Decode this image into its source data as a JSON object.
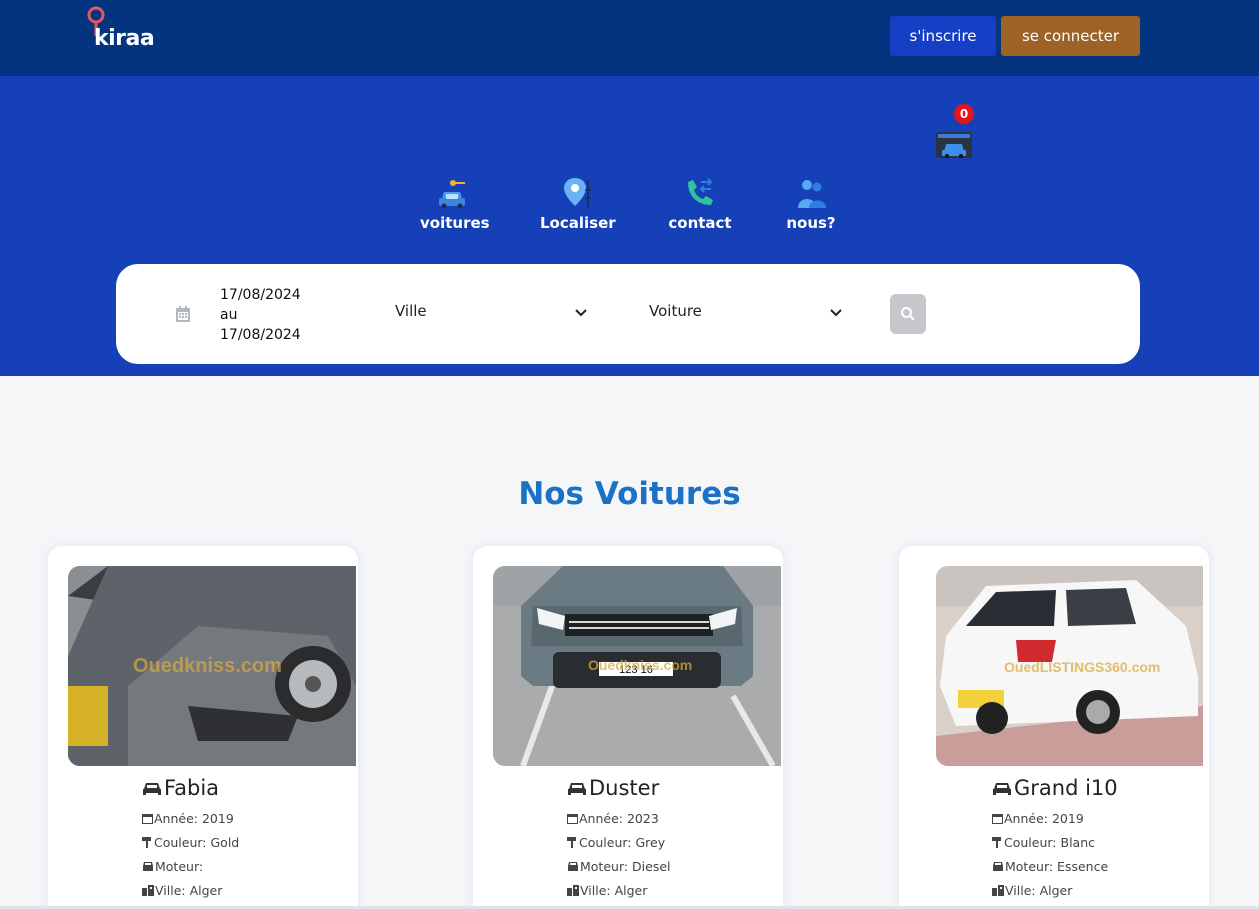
{
  "brand": {
    "logo_text": "kiraa"
  },
  "header": {
    "signup_label": "s'inscrire",
    "login_label": "se connecter"
  },
  "cart": {
    "count": "0",
    "icon": "cart-car-icon"
  },
  "nav": [
    {
      "label": "voitures",
      "icon": "car-key-icon"
    },
    {
      "label": "Localiser",
      "icon": "location-pin-icon"
    },
    {
      "label": "contact",
      "icon": "phone-call-icon"
    },
    {
      "label": "nous?",
      "icon": "people-icon"
    }
  ],
  "search": {
    "date_start": "17/08/2024",
    "date_sep": "au",
    "date_end": "17/08/2024",
    "city_placeholder": "Ville",
    "car_placeholder": "Voiture"
  },
  "section": {
    "title": "Nos Voitures"
  },
  "cars": [
    {
      "name": "Fabia",
      "year": "Année: 2019",
      "color": "Couleur: Gold",
      "engine": "Moteur:",
      "city": "Ville: Alger",
      "watermark": "Ouedkniss.com"
    },
    {
      "name": "Duster",
      "year": "Année: 2023",
      "color": "Couleur: Grey",
      "engine": "Moteur: Diesel",
      "city": "Ville: Alger",
      "watermark": "Ouedkniss.com",
      "plate": "123 16"
    },
    {
      "name": "Grand i10",
      "year": "Année: 2019",
      "color": "Couleur: Blanc",
      "engine": "Moteur: Essence",
      "city": "Ville: Alger",
      "watermark": "OuedLISTINGS360.com"
    }
  ],
  "colors": {
    "topbar": "#04347f",
    "hero": "#1640b8",
    "signup": "#153fc4",
    "login": "#9c6226",
    "title": "#1a71c5",
    "badge": "#e8121c"
  }
}
